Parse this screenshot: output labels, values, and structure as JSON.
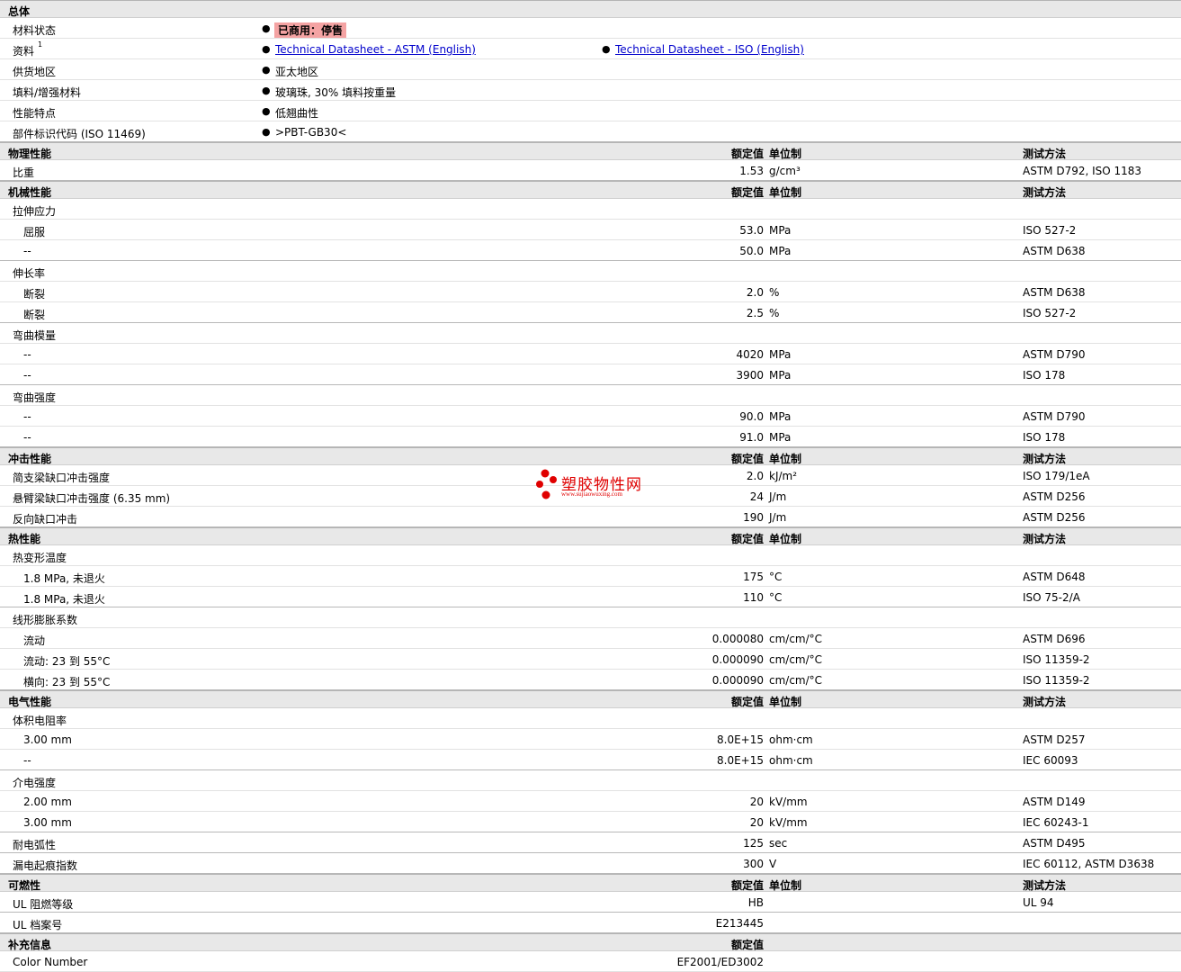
{
  "general": {
    "title": "总体",
    "rows": [
      {
        "label": "材料状态",
        "items": [
          {
            "text": "已商用：停售",
            "style": "badge"
          }
        ]
      },
      {
        "label": "资料",
        "sup": "1",
        "items": [
          {
            "text": "Technical Datasheet - ASTM (English)",
            "style": "link"
          },
          {
            "text": "Technical Datasheet - ISO (English)",
            "style": "link"
          }
        ]
      },
      {
        "label": "供货地区",
        "items": [
          {
            "text": "亚太地区"
          }
        ]
      },
      {
        "label": "填料/增强材料",
        "items": [
          {
            "text": "玻璃珠, 30% 填料按重量"
          }
        ]
      },
      {
        "label": "性能特点",
        "items": [
          {
            "text": "低翘曲性"
          }
        ]
      },
      {
        "label": "部件标识代码  (ISO 11469)",
        "items": [
          {
            "text": ">PBT-GB30<"
          }
        ]
      }
    ]
  },
  "sections": [
    {
      "title": "物理性能",
      "val_header": "额定值",
      "unit_header": "单位制",
      "method_header": "测试方法",
      "rows": [
        {
          "label": "比重",
          "value": "1.53",
          "unit": "g/cm³",
          "method": "ASTM D792, ISO 1183",
          "last": true
        }
      ]
    },
    {
      "title": "机械性能",
      "val_header": "额定值",
      "unit_header": "单位制",
      "method_header": "测试方法",
      "rows": [
        {
          "label": "拉伸应力"
        },
        {
          "label": "屈服",
          "sub": true,
          "value": "53.0",
          "unit": "MPa",
          "method": "ISO 527-2"
        },
        {
          "label": "--",
          "sub": true,
          "value": "50.0",
          "unit": "MPa",
          "method": "ASTM D638",
          "last": true
        },
        {
          "label": "伸长率"
        },
        {
          "label": "断裂",
          "sub": true,
          "value": "2.0",
          "unit": "%",
          "method": "ASTM D638"
        },
        {
          "label": "断裂",
          "sub": true,
          "value": "2.5",
          "unit": "%",
          "method": "ISO 527-2",
          "last": true
        },
        {
          "label": "弯曲模量"
        },
        {
          "label": "--",
          "sub": true,
          "value": "4020",
          "unit": "MPa",
          "method": "ASTM D790"
        },
        {
          "label": "--",
          "sub": true,
          "value": "3900",
          "unit": "MPa",
          "method": "ISO 178",
          "last": true
        },
        {
          "label": "弯曲强度"
        },
        {
          "label": "--",
          "sub": true,
          "value": "90.0",
          "unit": "MPa",
          "method": "ASTM D790"
        },
        {
          "label": "--",
          "sub": true,
          "value": "91.0",
          "unit": "MPa",
          "method": "ISO 178",
          "last": true
        }
      ]
    },
    {
      "title": "冲击性能",
      "val_header": "额定值",
      "unit_header": "单位制",
      "method_header": "测试方法",
      "rows": [
        {
          "label": "简支梁缺口冲击强度",
          "value": "2.0",
          "unit": "kJ/m²",
          "method": "ISO 179/1eA"
        },
        {
          "label": "悬臂梁缺口冲击强度  (6.35 mm)",
          "value": "24",
          "unit": "J/m",
          "method": "ASTM D256"
        },
        {
          "label": "反向缺口冲击",
          "value": "190",
          "unit": "J/m",
          "method": "ASTM D256",
          "last": true
        }
      ]
    },
    {
      "title": "热性能",
      "val_header": "额定值",
      "unit_header": "单位制",
      "method_header": "测试方法",
      "rows": [
        {
          "label": "热变形温度"
        },
        {
          "label": "1.8 MPa, 未退火",
          "sub": true,
          "value": "175",
          "unit": "°C",
          "method": "ASTM D648"
        },
        {
          "label": "1.8 MPa, 未退火",
          "sub": true,
          "value": "110",
          "unit": "°C",
          "method": "ISO 75-2/A",
          "last": true
        },
        {
          "label": "线形膨胀系数"
        },
        {
          "label": "流动",
          "sub": true,
          "value": "0.000080",
          "unit": "cm/cm/°C",
          "method": "ASTM D696"
        },
        {
          "label": "流动: 23 到  55°C",
          "sub": true,
          "value": "0.000090",
          "unit": "cm/cm/°C",
          "method": "ISO 11359-2"
        },
        {
          "label": "横向: 23 到  55°C",
          "sub": true,
          "value": "0.000090",
          "unit": "cm/cm/°C",
          "method": "ISO 11359-2",
          "last": true
        }
      ]
    },
    {
      "title": "电气性能",
      "val_header": "额定值",
      "unit_header": "单位制",
      "method_header": "测试方法",
      "rows": [
        {
          "label": "体积电阻率"
        },
        {
          "label": "3.00 mm",
          "sub": true,
          "value": "8.0E+15",
          "unit": "ohm·cm",
          "method": "ASTM D257"
        },
        {
          "label": "--",
          "sub": true,
          "value": "8.0E+15",
          "unit": "ohm·cm",
          "method": "IEC 60093",
          "last": true
        },
        {
          "label": "介电强度"
        },
        {
          "label": "2.00 mm",
          "sub": true,
          "value": "20",
          "unit": "kV/mm",
          "method": "ASTM D149"
        },
        {
          "label": "3.00 mm",
          "sub": true,
          "value": "20",
          "unit": "kV/mm",
          "method": "IEC 60243-1",
          "last": true
        },
        {
          "label": "耐电弧性",
          "value": "125",
          "unit": "sec",
          "method": "ASTM D495",
          "last": true
        },
        {
          "label": "漏电起痕指数",
          "value": "300",
          "unit": "V",
          "method": "IEC 60112, ASTM D3638",
          "last": true
        }
      ]
    },
    {
      "title": "可燃性",
      "val_header": "额定值",
      "unit_header": "单位制",
      "method_header": "测试方法",
      "rows": [
        {
          "label": "UL 阻燃等级",
          "value": "HB",
          "unit": "",
          "method": "UL 94",
          "last": true
        },
        {
          "label": "UL 档案号",
          "value": "E213445",
          "unit": "",
          "method": "",
          "last": true
        }
      ]
    },
    {
      "title": "补充信息",
      "val_header": "额定值",
      "unit_header": "",
      "method_header": "",
      "rows": [
        {
          "label": "Color Number",
          "value": "EF2001/ED3002",
          "unit": "",
          "method": ""
        }
      ]
    }
  ],
  "watermark": {
    "text": "塑胶物性网",
    "url": "www.sujiaowuxing.com",
    "dot_color": "#e00000"
  }
}
